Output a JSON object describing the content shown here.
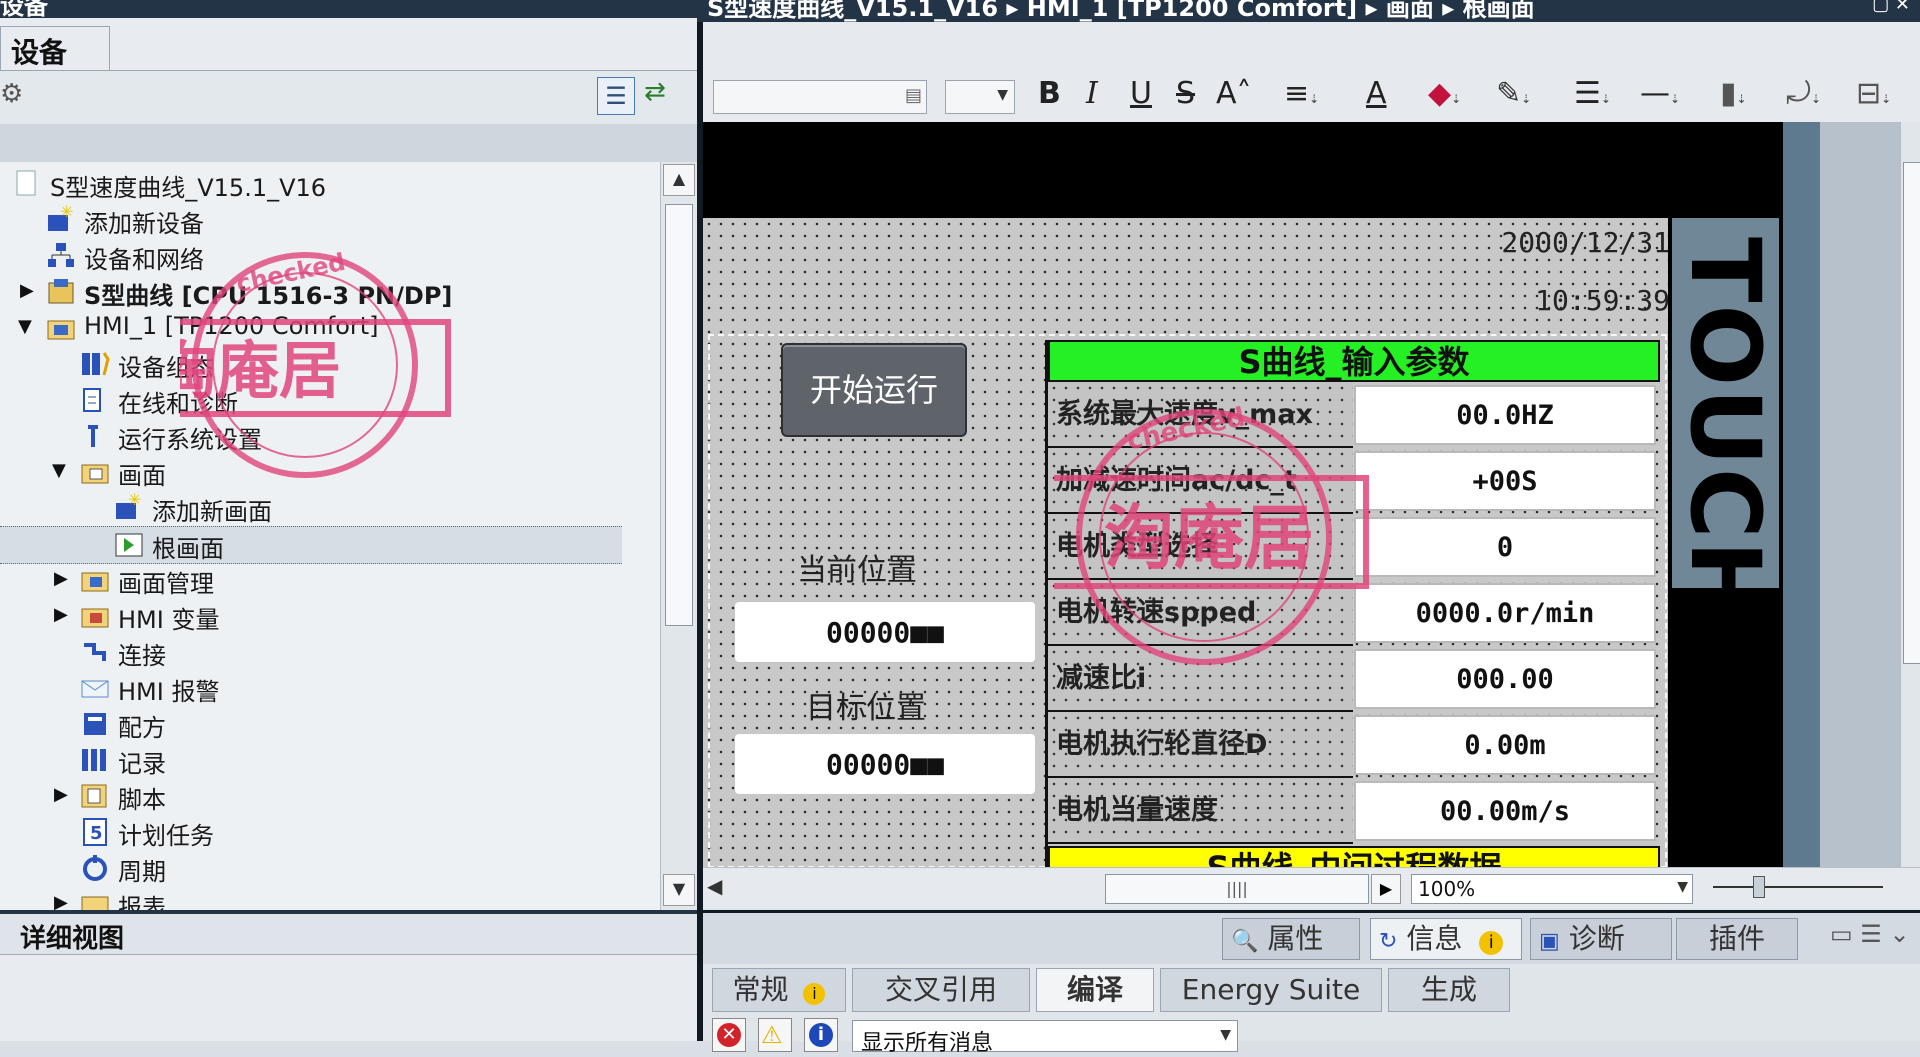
{
  "left_header": {
    "title_fragment": "设备"
  },
  "devices_tab": {
    "label": "设备"
  },
  "tree": [
    {
      "label": "S型速度曲线_V15.1_V16",
      "icon": "project-icon"
    },
    {
      "label": "添加新设备",
      "icon": "add-device-icon"
    },
    {
      "label": "设备和网络",
      "icon": "network-icon"
    },
    {
      "label": "S型曲线 [CPU 1516-3 PN/DP]",
      "icon": "cpu-icon"
    },
    {
      "label": "HMI_1 [TP1200 Comfort]",
      "icon": "hmi-folder-icon"
    },
    {
      "label": "设备组态",
      "icon": "device-config-icon"
    },
    {
      "label": "在线和诊断",
      "icon": "diagnostics-icon"
    },
    {
      "label": "运行系统设置",
      "icon": "runtime-settings-icon"
    },
    {
      "label": "画面",
      "icon": "folder-icon"
    },
    {
      "label": "添加新画面",
      "icon": "add-screen-icon"
    },
    {
      "label": "根画面",
      "icon": "screen-icon"
    },
    {
      "label": "画面管理",
      "icon": "screen-management-icon"
    },
    {
      "label": "HMI 变量",
      "icon": "tags-icon"
    },
    {
      "label": "连接",
      "icon": "connection-icon"
    },
    {
      "label": "HMI 报警",
      "icon": "alarm-icon"
    },
    {
      "label": "配方",
      "icon": "recipe-icon"
    },
    {
      "label": "记录",
      "icon": "log-icon"
    },
    {
      "label": "脚本",
      "icon": "script-icon"
    },
    {
      "label": "计划任务",
      "icon": "scheduler-icon"
    },
    {
      "label": "周期",
      "icon": "cycle-icon"
    },
    {
      "label": "报表",
      "icon": "report-icon"
    }
  ],
  "details": {
    "title": "详细视图"
  },
  "editor": {
    "breadcrumb": "S型速度曲线_V15.1_V16 ▸ HMI_1 [TP1200 Comfort] ▸ 画面 ▸ 根画面"
  },
  "toolbar": {
    "bold": "B",
    "italic": "I",
    "underline": "U",
    "strike": "S",
    "fontsize": "A˄",
    "font_color": "A"
  },
  "hmi": {
    "date": "2000/12/31",
    "time": "10:59:39",
    "start_button": "开始运行",
    "current_pos_label": "当前位置",
    "current_pos_value": "00000■■",
    "target_pos_label": "目标位置",
    "target_pos_value": "00000■■",
    "brand": "TOUCH",
    "section_title": "S曲线_输入参数",
    "params": [
      {
        "label": "系统最大速度v_max",
        "value": "00.0HZ"
      },
      {
        "label": "加减速时间ac/dc_t",
        "value": "+00S"
      },
      {
        "label": "电机类型选择",
        "value": "0"
      },
      {
        "label": "电机转速spped",
        "value": "0000.0r/min"
      },
      {
        "label": "减速比i",
        "value": "000.00"
      },
      {
        "label": "电机执行轮直径D",
        "value": "0.00m"
      },
      {
        "label": "电机当量速度",
        "value": "00.00m/s"
      }
    ],
    "section2_title": "S曲线_中间过程数据"
  },
  "zoom": {
    "value": "100%"
  },
  "inspector_tabs": {
    "properties": "属性",
    "info": "信息",
    "diagnostics": "诊断",
    "plugins": "插件"
  },
  "lower_tabs": [
    "常规",
    "交叉引用",
    "编译",
    "Energy Suite",
    "生成"
  ],
  "filter": {
    "value": "显示所有消息"
  },
  "watermark": {
    "text": "淘庵居",
    "ring_text": "checked"
  },
  "colors": {
    "green": "#25f024",
    "yellow": "#ffff00",
    "stamp": "#e0457a",
    "dark_title": "#233447"
  }
}
